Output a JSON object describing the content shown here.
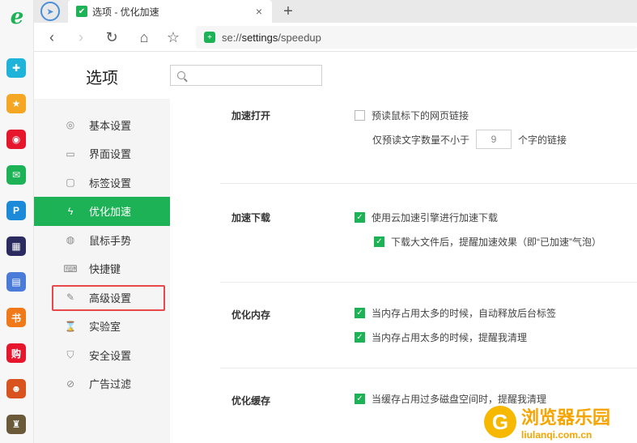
{
  "rail": {
    "logo": "e",
    "apps": [
      {
        "name": "plus-app-icon",
        "glyph": "✚",
        "color": "#1fb3d9"
      },
      {
        "name": "star-app-icon",
        "glyph": "★",
        "color": "#f5a623"
      },
      {
        "name": "weibo-app-icon",
        "glyph": "◉",
        "color": "#e6162d"
      },
      {
        "name": "mail-app-icon",
        "glyph": "✉",
        "color": "#1db255"
      },
      {
        "name": "p-app-icon",
        "glyph": "P",
        "color": "#1a8ad9"
      },
      {
        "name": "news-app-icon",
        "glyph": "▦",
        "color": "#2b2b5f"
      },
      {
        "name": "doc-app-icon",
        "glyph": "▤",
        "color": "#4a7bd9"
      },
      {
        "name": "novel-app-icon",
        "glyph": "书",
        "color": "#f07a1a"
      },
      {
        "name": "shop-app-icon",
        "glyph": "购",
        "color": "#e6162d"
      },
      {
        "name": "game-app-icon",
        "glyph": "☻",
        "color": "#d9531e"
      },
      {
        "name": "castle-app-icon",
        "glyph": "♜",
        "color": "#6a5a3a"
      }
    ]
  },
  "tab": {
    "title": "选项 - 优化加速",
    "close": "×",
    "new_tab": "+"
  },
  "toolbar": {
    "url_prefix": "se://",
    "url_main": "settings",
    "url_suffix": "/speedup"
  },
  "page": {
    "title": "选项",
    "search_placeholder": ""
  },
  "sidebar": {
    "items": [
      {
        "label": "基本设置",
        "icon": "◎"
      },
      {
        "label": "界面设置",
        "icon": "▭"
      },
      {
        "label": "标签设置",
        "icon": "▢"
      },
      {
        "label": "优化加速",
        "icon": "ϟ"
      },
      {
        "label": "鼠标手势",
        "icon": "◍"
      },
      {
        "label": "快捷键",
        "icon": "⌨"
      },
      {
        "label": "高级设置",
        "icon": "✎"
      },
      {
        "label": "实验室",
        "icon": "⌛"
      },
      {
        "label": "安全设置",
        "icon": "⛉"
      },
      {
        "label": "广告过滤",
        "icon": "⊘"
      }
    ],
    "active_index": 3,
    "highlighted_index": 6
  },
  "sections": {
    "open": {
      "label": "加速打开",
      "opt1": "预读鼠标下的网页链接",
      "opt1_checked": false,
      "sub_prefix": "仅预读文字数量不小于",
      "sub_value": "9",
      "sub_suffix": "个字的链接"
    },
    "download": {
      "label": "加速下载",
      "opt1": "使用云加速引擎进行加速下载",
      "opt2": "下载大文件后，提醒加速效果（即“已加速”气泡）"
    },
    "memory": {
      "label": "优化内存",
      "opt1": "当内存占用太多的时候，自动释放后台标签",
      "opt2": "当内存占用太多的时候，提醒我清理"
    },
    "cache": {
      "label": "优化缓存",
      "opt1": "当缓存占用过多磁盘空间时，提醒我清理"
    }
  },
  "watermark": {
    "text": "浏览器乐园",
    "domain": "liulanqi.com.cn"
  }
}
